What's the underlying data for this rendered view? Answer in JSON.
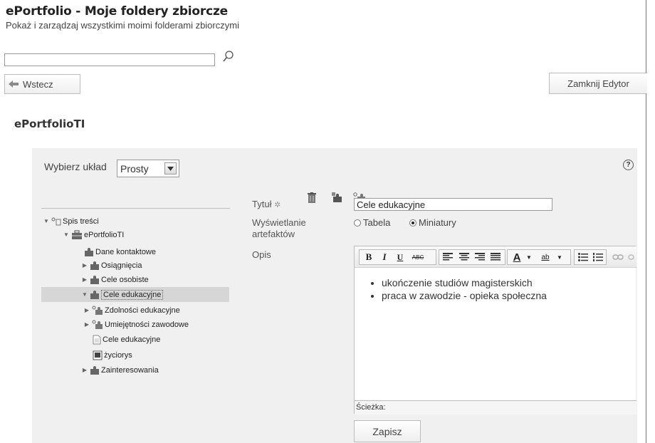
{
  "header": {
    "title": "ePortfolio - Moje foldery zbiorcze",
    "subtitle": "Pokaż i zarządzaj wszystkimi moimi folderami zbiorczymi"
  },
  "search": {
    "value": "",
    "placeholder": ""
  },
  "toolbar": {
    "back_label": "Wstecz",
    "close_editor_label": "Zamknij Edytor"
  },
  "portfolio": {
    "title": "ePortfolioTI"
  },
  "layout": {
    "label": "Wybierz układ",
    "selected": "Prosty",
    "help": "?"
  },
  "tree": {
    "root": "Spis treści",
    "portfolio_node": "ePortfolioTI",
    "items": [
      {
        "label": "Dane kontaktowe"
      },
      {
        "label": "Osiągnięcia"
      },
      {
        "label": "Cele osobiste"
      },
      {
        "label": "Cele edukacyjne"
      },
      {
        "label": "Zdolności edukacyjne"
      },
      {
        "label": "Umiejętności zawodowe"
      },
      {
        "label": "Cele edukacyjne"
      },
      {
        "label": "życiorys"
      },
      {
        "label": "Zainteresowania"
      }
    ]
  },
  "form": {
    "title_label": "Tytuł",
    "title_value": "Cele edukacyjne",
    "display_label_1": "Wyświetlanie",
    "display_label_2": "artefaktów",
    "options": [
      "Tabela",
      "Miniatury"
    ],
    "selected_option": "Miniatury",
    "description_label": "Opis",
    "editor_bullets": [
      "ukończenie studiów magisterskich",
      "praca w zawodzie - opieka społeczna"
    ],
    "editor_path_label": "Ścieżka:",
    "save_label": "Zapisz"
  },
  "editor_toolbar": {
    "bold": "B",
    "italic": "I",
    "underline": "U",
    "strike": "ABC",
    "font_color": "A",
    "highlight": "ab"
  }
}
